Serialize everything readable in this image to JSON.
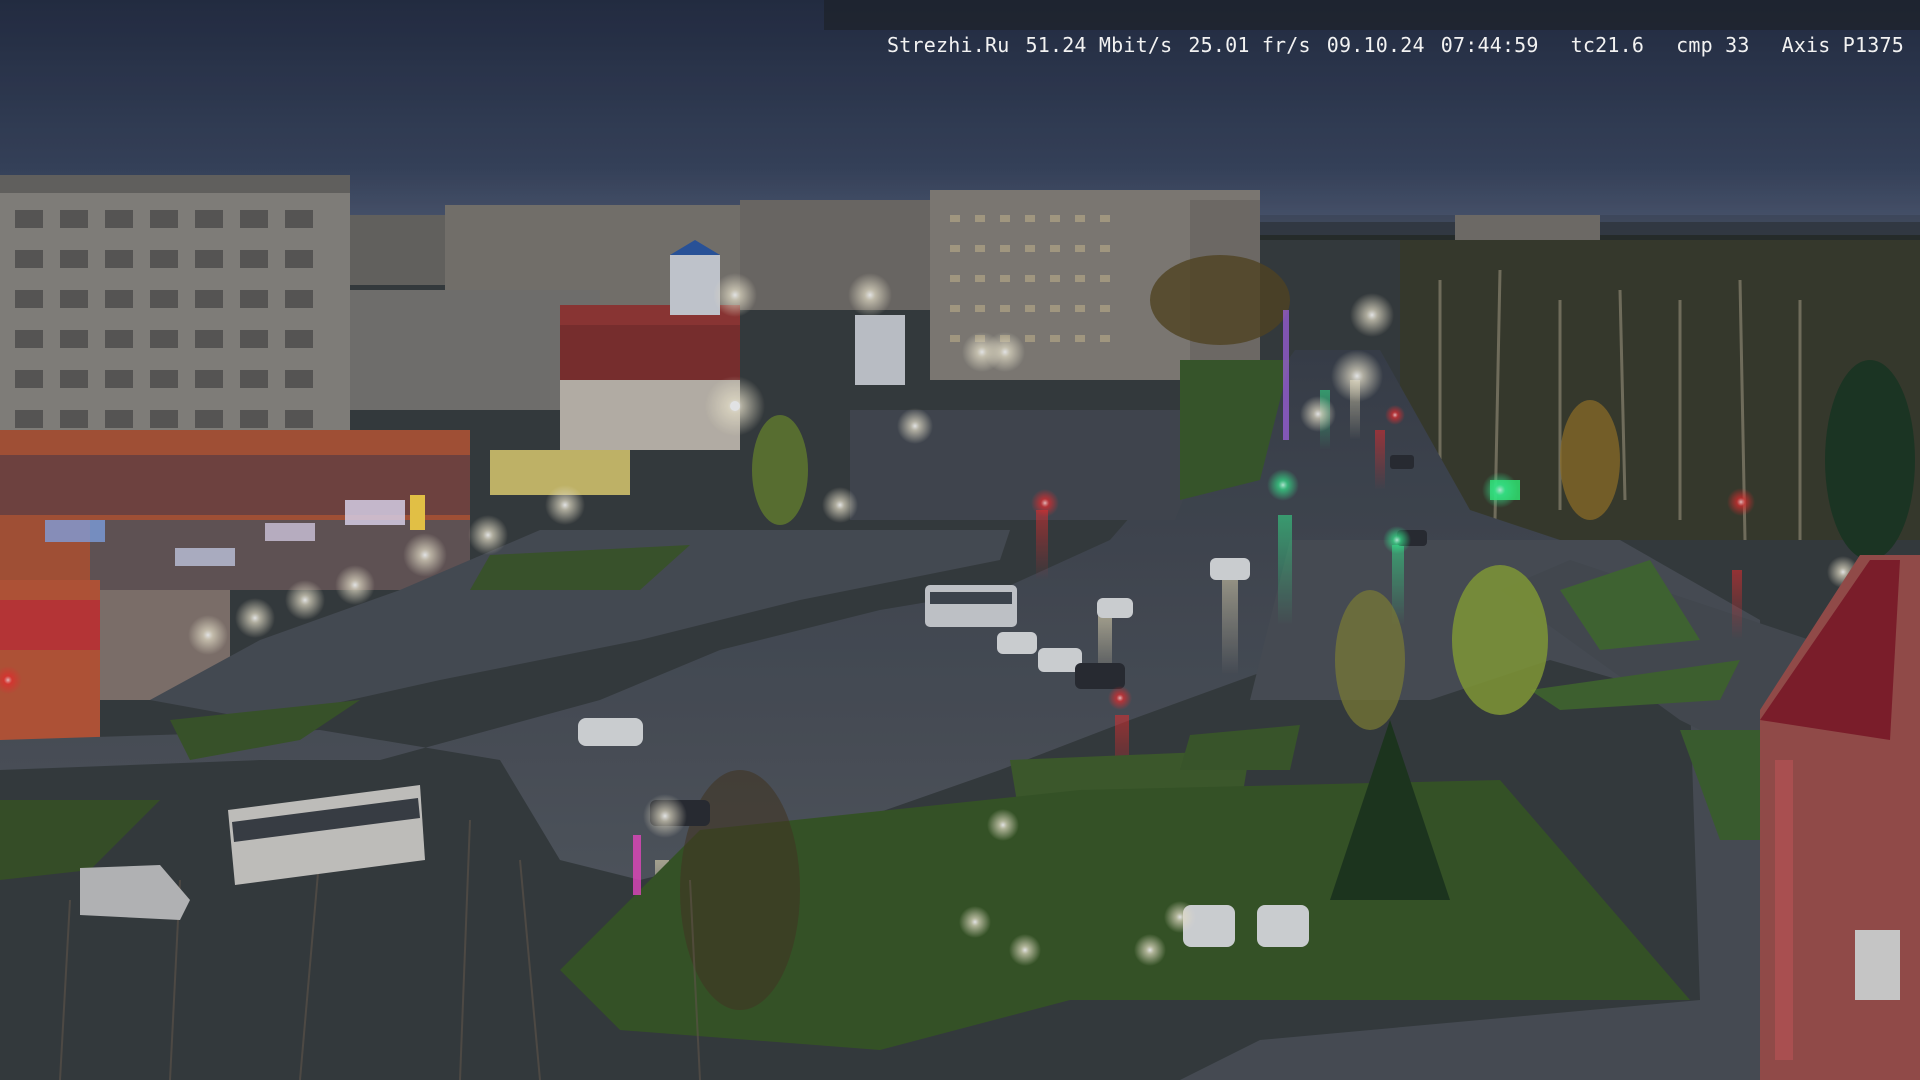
{
  "camera_overlay": {
    "site": "Strezhi.Ru",
    "bitrate": "51.24 Mbit/s",
    "framerate": "25.01 fr/s",
    "date": "09.10.24",
    "time": "07:44:59",
    "temperature": "tc21.6",
    "compression": "cmp 33",
    "camera_model": "Axis P1375"
  },
  "scene": {
    "description_type": "webcam-street-view",
    "colors": {
      "sky_top": "#27324a",
      "sky_horizon": "#4a5670",
      "road_wet": "#4b5058",
      "grass": "#3d5a2c",
      "building_panel": "#8e8a84",
      "store_facade": "#b55a38",
      "red_building": "#8e2a2e",
      "street_light": "#ffffff",
      "traffic_green": "#3cff9a",
      "traffic_red": "#ff3030"
    }
  }
}
